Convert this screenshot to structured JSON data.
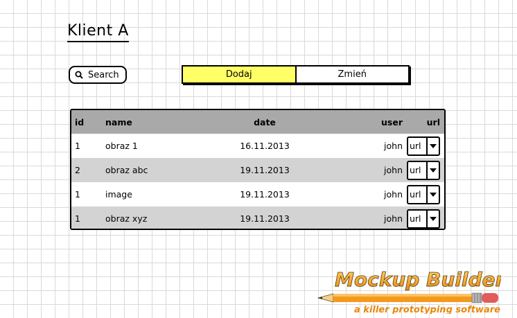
{
  "header": {
    "title": "Klient A"
  },
  "search": {
    "label": "Search"
  },
  "actions": {
    "add_label": "Dodaj",
    "change_label": "Zmień"
  },
  "table": {
    "columns": {
      "id": "id",
      "name": "name",
      "date": "date",
      "user": "user",
      "url": "url"
    },
    "rows": [
      {
        "id": "1",
        "name": "obraz 1",
        "date": "16.11.2013",
        "user": "john",
        "url": "url"
      },
      {
        "id": "2",
        "name": "obraz abc",
        "date": "19.11.2013",
        "user": "john",
        "url": "url"
      },
      {
        "id": "1",
        "name": "image",
        "date": "19.11.2013",
        "user": "john",
        "url": "url"
      },
      {
        "id": "1",
        "name": "obraz xyz",
        "date": "19.11.2013",
        "user": "john",
        "url": "url"
      }
    ]
  },
  "branding": {
    "logo_text": "Mockup Builder",
    "tagline": "a killer prototyping software",
    "accent_color": "#f39a1e",
    "button_highlight": "#ffff66",
    "header_gray": "#a9a9a9",
    "row_alt_gray": "#d3d3d3"
  }
}
